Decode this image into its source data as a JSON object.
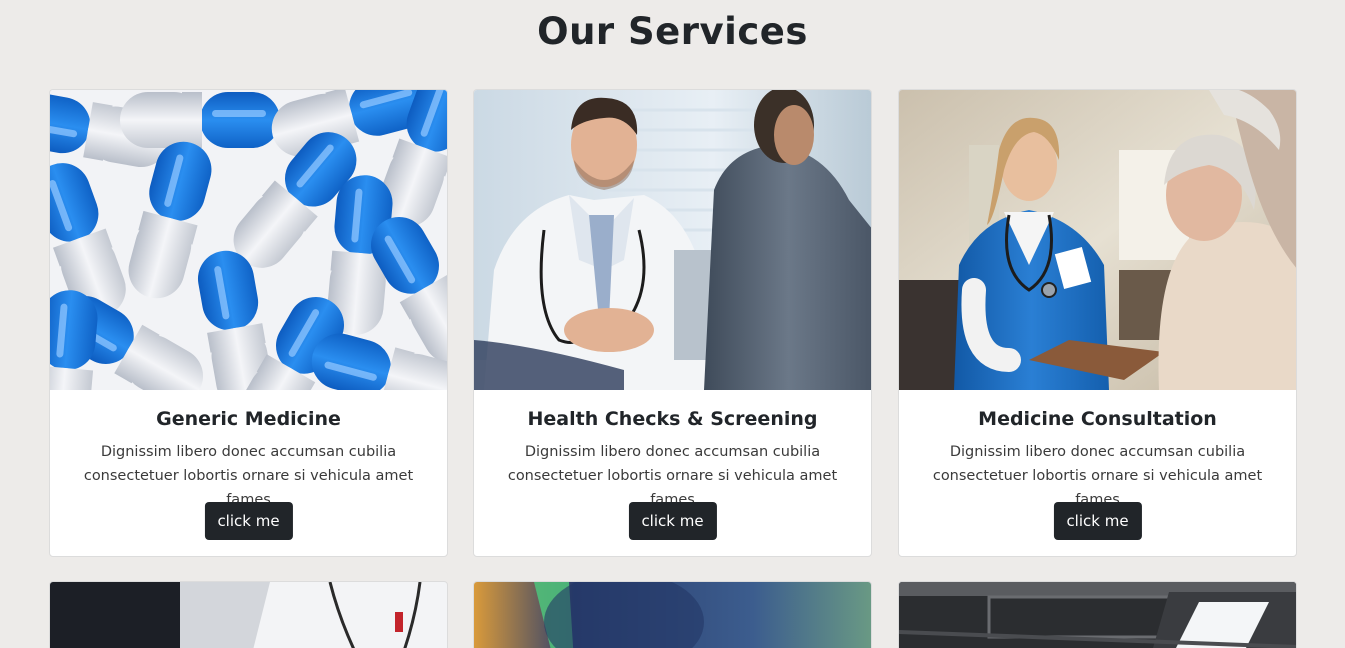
{
  "page": {
    "title": "Our Services"
  },
  "services": [
    {
      "title": "Generic Medicine",
      "text": "Dignissim libero donec accumsan cubilia consectetuer lobortis ornare si vehicula amet fames",
      "button": "click me",
      "image": "blue-white-capsules-photo"
    },
    {
      "title": "Health Checks & Screening",
      "text": "Dignissim libero donec accumsan cubilia consectetuer lobortis ornare si vehicula amet fames",
      "button": "click me",
      "image": "doctor-with-patient-photo"
    },
    {
      "title": "Medicine Consultation",
      "text": "Dignissim libero donec accumsan cubilia consectetuer lobortis ornare si vehicula amet fames",
      "button": "click me",
      "image": "nurse-with-elderly-patient-photo"
    }
  ],
  "more_services_images": [
    "doctor-coat-photo",
    "syringe-photo",
    "ceiling-light-photo"
  ],
  "colors": {
    "background": "#edebe9",
    "button": "#212529",
    "accent_blue": "#1e82e0"
  }
}
